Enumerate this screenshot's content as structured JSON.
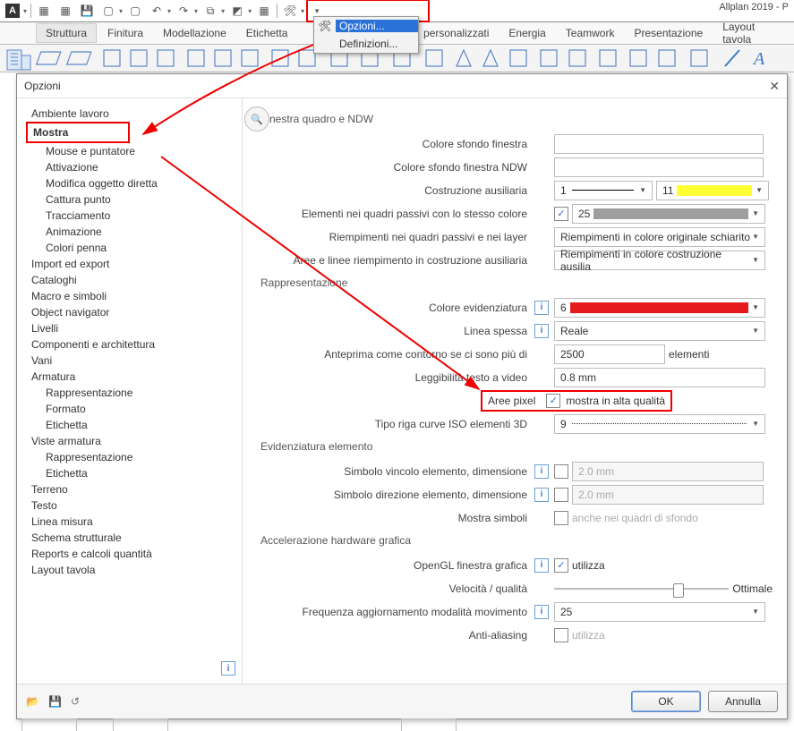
{
  "app": {
    "title": "Allplan 2019 - P"
  },
  "menubar": {
    "items": [
      "Struttura",
      "Finitura",
      "Modellazione",
      "Etichetta",
      "",
      "personalizzati",
      "Energia",
      "Teamwork",
      "Presentazione",
      "Layout tavola"
    ]
  },
  "dropdown": {
    "items": [
      "Opzioni...",
      "Definizioni..."
    ]
  },
  "dialog": {
    "title": "Opzioni",
    "ok": "OK",
    "cancel": "Annulla"
  },
  "tree": {
    "items": [
      "Ambiente lavoro",
      "Mostra",
      "Mouse e puntatore",
      "Attivazione",
      "Modifica oggetto diretta",
      "Cattura punto",
      "Tracciamento",
      "Animazione",
      "Colori penna",
      "Import ed export",
      "Cataloghi",
      "Macro e simboli",
      "Object navigator",
      "Livelli",
      "Componenti e architettura",
      "Vani",
      "Armatura",
      "Rappresentazione",
      "Formato",
      "Etichetta",
      "Viste armatura",
      "Rappresentazione",
      "Etichetta",
      "Terreno",
      "Testo",
      "Linea misura",
      "Schema strutturale",
      "Reports e calcoli quantità",
      "Layout tavola"
    ]
  },
  "groups": {
    "g1": "Finestra quadro e NDW",
    "g2": "Rappresentazione",
    "g3": "Evidenziatura elemento",
    "g4": "Accelerazione hardware grafica"
  },
  "labels": {
    "r1": "Colore sfondo finestra",
    "r2": "Colore sfondo finestra NDW",
    "r3": "Costruzione ausiliaria",
    "r4": "Elementi nei quadri passivi con lo stesso colore",
    "r5": "Riempimenti nei quadri passivi e nei layer",
    "r6": "Aree e linee riempimento in costruzione ausiliaria",
    "r7": "Colore evidenziatura",
    "r8": "Linea spessa",
    "r9": "Anteprima come contorno se ci sono più di",
    "r9_suffix": "elementi",
    "r10": "Leggibilità testo a video",
    "r11": "Aree pixel",
    "r11_chk": "mostra in alta qualità",
    "r12": "Tipo riga curve ISO elementi 3D",
    "r13": "Simbolo vincolo elemento, dimensione",
    "r14": "Simbolo direzione elemento, dimensione",
    "r15": "Mostra simboli",
    "r15_chk": "anche nei quadri di sfondo",
    "r16": "OpenGL finestra grafica",
    "r16_chk": "utilizza",
    "r17": "Velocità / qualità",
    "r17_suffix": "Ottimale",
    "r18": "Frequenza aggiornamento modalità movimento",
    "r19": "Anti-aliasing",
    "r19_chk": "utilizza"
  },
  "values": {
    "r3_num1": "1",
    "r3_num2": "11",
    "r4_num": "25",
    "r5": "Riempimenti in colore originale schiarito",
    "r6": "Riempimenti in colore costruzione ausilia",
    "r7_num": "6",
    "r8": "Reale",
    "r9": "2500",
    "r10": "0.8 mm",
    "r12": "9",
    "r13": "2.0 mm",
    "r14": "2.0 mm",
    "r18": "25"
  },
  "colors": {
    "swatch_r3": "#ffff33",
    "swatch_r4": "#9e9e9e",
    "swatch_r7": "#e51a1a"
  }
}
